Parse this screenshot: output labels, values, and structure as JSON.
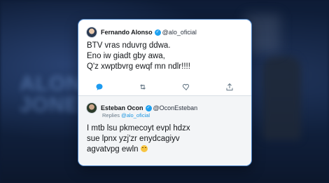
{
  "tweet": {
    "author_name": "Fernando Alonso",
    "author_handle": "@alo_oficial",
    "lines": [
      "BTV vras nduvrg ddwa.",
      "Eno iw giadt gby awa,",
      "Q'z xwptbvrg ewqf mn ndlr!!!!"
    ],
    "icons": [
      "comment-icon",
      "retweet-icon",
      "like-icon",
      "share-icon"
    ]
  },
  "reply": {
    "author_name": "Esteban Ocon",
    "author_handle": "@OconEsteban",
    "replying_prefix": "Replies",
    "replying_to": "@alo_oficial",
    "lines": [
      "I mtb lsu pkmecoyt evpl hdzx",
      "sue lpnx yzj'zr enydcagiyv",
      "agvatvpg ewln"
    ],
    "emoji": "smiling-face-emoji"
  },
  "background": {
    "blurred_text_lines": [
      "ALON",
      "JONE"
    ]
  },
  "colors": {
    "verified": "#1da1f2",
    "mention": "#1b95e0",
    "card_border": "#4a83c8"
  }
}
